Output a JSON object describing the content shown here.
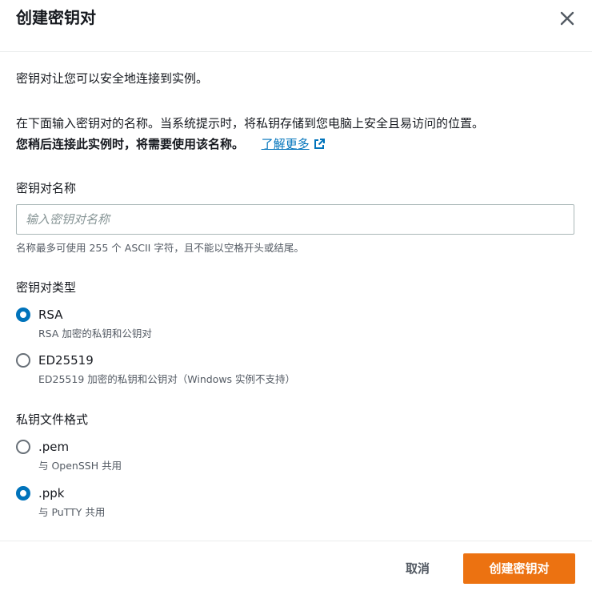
{
  "dialog": {
    "title": "创建密钥对",
    "intro": "密钥对让您可以安全地连接到实例。",
    "instruction": "在下面输入密钥对的名称。当系统提示时，将私钥存储到您电脑上安全且易访问的位置。",
    "instruction_bold": "您稍后连接此实例时，将需要使用该名称。",
    "learn_more": "了解更多"
  },
  "name_field": {
    "label": "密钥对名称",
    "placeholder": "输入密钥对名称",
    "value": "",
    "hint": "名称最多可使用 255 个 ASCII 字符，且不能以空格开头或结尾。"
  },
  "key_type": {
    "label": "密钥对类型",
    "options": [
      {
        "label": "RSA",
        "desc": "RSA 加密的私钥和公钥对",
        "checked": true
      },
      {
        "label": "ED25519",
        "desc": "ED25519 加密的私钥和公钥对（Windows 实例不支持）",
        "checked": false
      }
    ]
  },
  "file_format": {
    "label": "私钥文件格式",
    "options": [
      {
        "label": ".pem",
        "desc": "与 OpenSSH 共用",
        "checked": false
      },
      {
        "label": ".ppk",
        "desc": "与 PuTTY 共用",
        "checked": true
      }
    ]
  },
  "footer": {
    "cancel": "取消",
    "create": "创建密钥对"
  },
  "colors": {
    "primary_button": "#ec7211",
    "link": "#0073bb",
    "radio_checked": "#0073bb"
  },
  "icons": {
    "close": "close-icon",
    "external": "external-link-icon"
  }
}
